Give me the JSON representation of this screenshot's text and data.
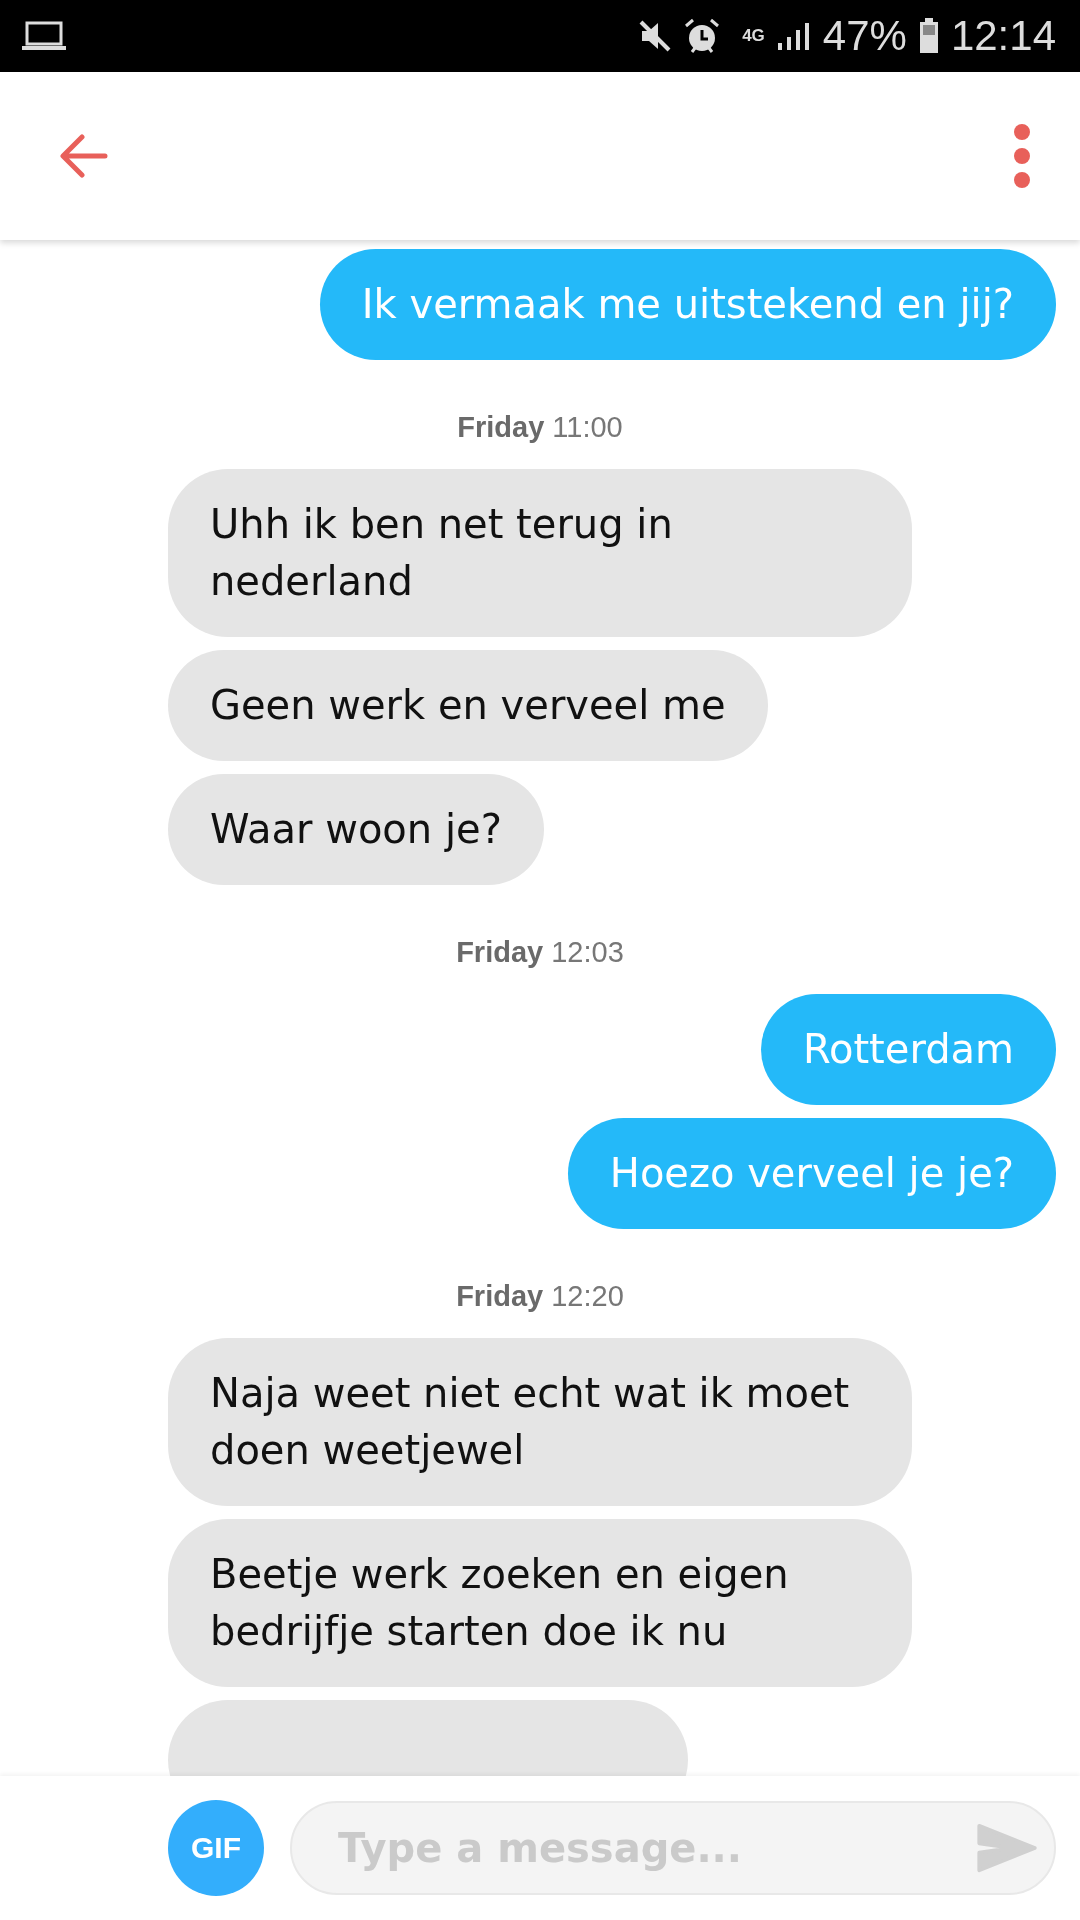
{
  "status_bar": {
    "network": "4G",
    "battery": "47%",
    "time": "12:14"
  },
  "messages": [
    {
      "kind": "sent",
      "text": "Ik vermaak me uitstekend en jij?"
    },
    {
      "kind": "timestamp",
      "text": "**Friday** 11:00"
    },
    {
      "kind": "received",
      "text": "Uhh ik ben net terug in nederland"
    },
    {
      "kind": "received",
      "text": "Geen werk en verveel me"
    },
    {
      "kind": "received",
      "text": "Waar woon je?"
    },
    {
      "kind": "timestamp",
      "text": "**Friday** 12:03"
    },
    {
      "kind": "sent",
      "text": "Rotterdam"
    },
    {
      "kind": "sent",
      "text": "Hoezo verveel je je?"
    },
    {
      "kind": "timestamp",
      "text": "**Friday** 12:20"
    },
    {
      "kind": "received",
      "text": "Naja weet niet echt wat ik moet doen weetjewel"
    },
    {
      "kind": "received",
      "text": "Beetje werk zoeken en eigen bedrijfje starten doe ik nu"
    },
    {
      "kind": "received"
    }
  ],
  "composer": {
    "gif_label": "GIF",
    "placeholder": "Type a message..."
  }
}
